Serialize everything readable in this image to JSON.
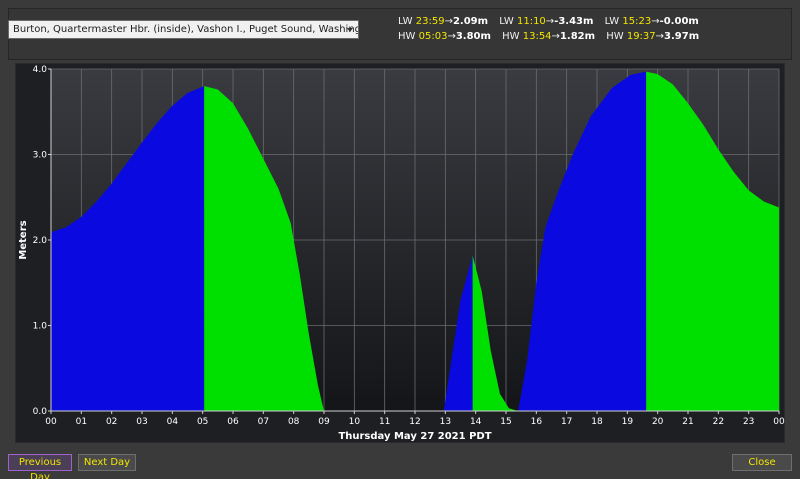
{
  "station": {
    "selected": "Burton, Quartermaster Hbr. (inside), Vashon I., Puget Sound, Washington"
  },
  "tides": {
    "top": [
      {
        "type": "LW",
        "time": "23:59",
        "arrow": "→",
        "height": "2.09m"
      },
      {
        "type": "LW",
        "time": "11:10",
        "arrow": "→",
        "height": "-3.43m"
      },
      {
        "type": "LW",
        "time": "15:23",
        "arrow": "→",
        "height": "-0.00m"
      }
    ],
    "bottom": [
      {
        "type": "HW",
        "time": "05:03",
        "arrow": "→",
        "height": "3.80m"
      },
      {
        "type": "HW",
        "time": "13:54",
        "arrow": "→",
        "height": "1.82m"
      },
      {
        "type": "HW",
        "time": "19:37",
        "arrow": "→",
        "height": "3.97m"
      }
    ]
  },
  "chart_data": {
    "type": "area",
    "xlabel": "Thursday May 27 2021 PDT",
    "ylabel": "Meters",
    "xlim": [
      0,
      24
    ],
    "ylim": [
      0,
      4
    ],
    "x_tick_labels": [
      "00",
      "01",
      "02",
      "03",
      "04",
      "05",
      "06",
      "07",
      "08",
      "09",
      "10",
      "11",
      "12",
      "13",
      "14",
      "15",
      "16",
      "17",
      "18",
      "19",
      "20",
      "21",
      "22",
      "23",
      "00"
    ],
    "y_tick_labels": [
      "0.0",
      "1.0",
      "2.0",
      "3.0",
      "4.0"
    ],
    "y_ticks": [
      0,
      1,
      2,
      3,
      4
    ],
    "grid": true,
    "colors": {
      "rising": "#0a0ae0",
      "falling": "#00e000"
    },
    "series": [
      {
        "direction": "rising",
        "points": [
          [
            0,
            2.09
          ],
          [
            0.5,
            2.15
          ],
          [
            1,
            2.27
          ],
          [
            1.5,
            2.45
          ],
          [
            2,
            2.66
          ],
          [
            2.5,
            2.9
          ],
          [
            3,
            3.14
          ],
          [
            3.5,
            3.37
          ],
          [
            4,
            3.57
          ],
          [
            4.5,
            3.72
          ],
          [
            5.05,
            3.8
          ]
        ]
      },
      {
        "direction": "falling",
        "points": [
          [
            5.05,
            3.8
          ],
          [
            5.5,
            3.76
          ],
          [
            6,
            3.6
          ],
          [
            6.5,
            3.3
          ],
          [
            7,
            2.95
          ],
          [
            7.5,
            2.6
          ],
          [
            7.9,
            2.2
          ],
          [
            8.2,
            1.6
          ],
          [
            8.5,
            0.9
          ],
          [
            8.8,
            0.3
          ],
          [
            9.0,
            0
          ]
        ]
      },
      {
        "direction": "rising",
        "points": [
          [
            12.95,
            0
          ],
          [
            13.2,
            0.6
          ],
          [
            13.5,
            1.3
          ],
          [
            13.9,
            1.82
          ]
        ]
      },
      {
        "direction": "falling",
        "points": [
          [
            13.9,
            1.82
          ],
          [
            14.2,
            1.4
          ],
          [
            14.5,
            0.7
          ],
          [
            14.8,
            0.2
          ],
          [
            15.1,
            0.03
          ],
          [
            15.4,
            0
          ]
        ]
      },
      {
        "direction": "rising",
        "points": [
          [
            15.4,
            0
          ],
          [
            15.7,
            0.6
          ],
          [
            16,
            1.5
          ],
          [
            16.3,
            2.15
          ],
          [
            16.7,
            2.55
          ],
          [
            17.2,
            3.0
          ],
          [
            17.8,
            3.45
          ],
          [
            18.5,
            3.78
          ],
          [
            19.1,
            3.93
          ],
          [
            19.62,
            3.97
          ]
        ]
      },
      {
        "direction": "falling",
        "points": [
          [
            19.62,
            3.97
          ],
          [
            20,
            3.94
          ],
          [
            20.5,
            3.82
          ],
          [
            21,
            3.6
          ],
          [
            21.5,
            3.35
          ],
          [
            22,
            3.06
          ],
          [
            22.5,
            2.8
          ],
          [
            23,
            2.58
          ],
          [
            23.5,
            2.45
          ],
          [
            24,
            2.38
          ]
        ]
      }
    ]
  },
  "buttons": {
    "previous_day": "Previous Day",
    "next_day": "Next Day",
    "close": "Close"
  },
  "icons": {
    "dropdown": "chevron-down-icon"
  }
}
